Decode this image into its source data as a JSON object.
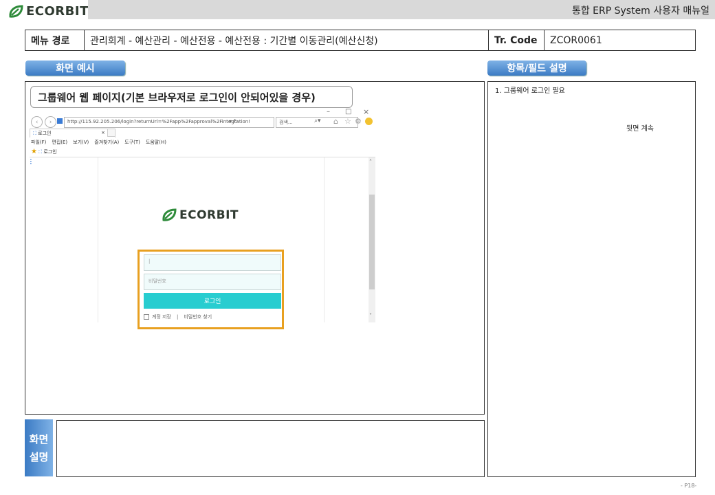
{
  "header": {
    "brand": "ECORBIT",
    "title": "통합 ERP System 사용자 매뉴얼"
  },
  "info": {
    "menu_path_label": "메뉴 경로",
    "menu_path_value": "관리회계 - 예산관리 - 예산전용 - 예산전용 : 기간별 이동관리(예산신청)",
    "tr_code_label": "Tr. Code",
    "tr_code_value": "ZCOR0061"
  },
  "tabs": {
    "screen_example": "화면 예시",
    "field_desc": "항목/필드 설명"
  },
  "screenshot": {
    "caption": "그룹웨어 웹 페이지(기본 브라우저로 로그인이 안되어있을 경우)",
    "window_controls": {
      "minimize": "–",
      "maximize": "□",
      "close": "×"
    },
    "address_url": "http://115.92.205.206/login?returnUrl=%2Fapp%2Fapproval%2Fintegration!",
    "search_placeholder": "검색...",
    "tab_label": "로그인",
    "menu_items": [
      "파일(F)",
      "편집(E)",
      "보기(V)",
      "즐겨찾기(A)",
      "도구(T)",
      "도움말(H)"
    ],
    "fav_label": "로그인",
    "brand": "ECORBIT",
    "id_field_value": "|",
    "pw_placeholder": "비밀번호",
    "login_button": "로그인",
    "remember_label": "계정 저장",
    "separator": "|",
    "find_pw_link": "비밀번호 찾기"
  },
  "field_desc": {
    "item1": "1. 그룹웨어 로그인 필요",
    "continue_note": "뒷면 계속"
  },
  "screen_desc": {
    "label_line1": "화면",
    "label_line2": "설명",
    "content": ""
  },
  "footer": {
    "page": "- P18-"
  },
  "colors": {
    "tab_blue": "#3b7bc4",
    "login_teal": "#28cdd0",
    "highlight_orange": "#e8a020",
    "brand_green": "#2e8b3a"
  }
}
